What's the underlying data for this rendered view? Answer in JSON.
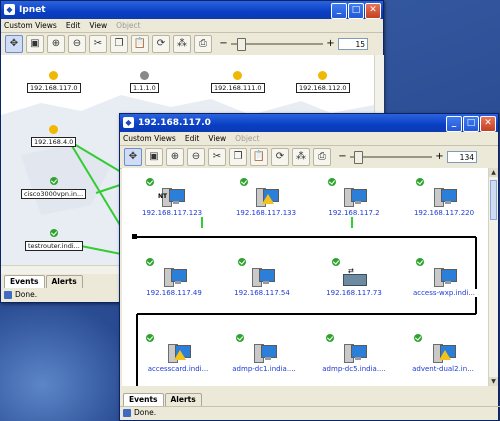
{
  "colors": {
    "title_bar": "#0a3fc4",
    "check_ok": "#2fa32f",
    "warning": "#f0b800",
    "link_green": "#33cc33",
    "node_text": "#1f3bd6"
  },
  "back_window": {
    "title": "Ipnet",
    "menu": [
      "Custom Views",
      "Edit",
      "View",
      "Object"
    ],
    "zoom_value": "15",
    "nodes": [
      "192.168.117.0",
      "1.1.1.0",
      "192.168.111.0",
      "192.168.112.0",
      "192.168.4.0",
      "cisco3000vpn.in...",
      "testrouter.indi..."
    ],
    "tabs": [
      "Events",
      "Alerts"
    ],
    "status": "Done."
  },
  "front_window": {
    "title": "192.168.117.0",
    "menu": [
      "Custom Views",
      "Edit",
      "View",
      "Object"
    ],
    "zoom_value": "134",
    "nodes": [
      "192.168.117.123",
      "192.168.117.133",
      "192.168.117.2",
      "192.168.117.220",
      "192.168.117.49",
      "192.168.117.54",
      "192.168.117.73",
      "access-wxp.indi...",
      "accesscard.indi...",
      "admp-dc1.india....",
      "admp-dc5.india....",
      "advent-dual2.in..."
    ],
    "nt_badge": "NT",
    "tabs": [
      "Events",
      "Alerts"
    ],
    "status": "Done."
  }
}
